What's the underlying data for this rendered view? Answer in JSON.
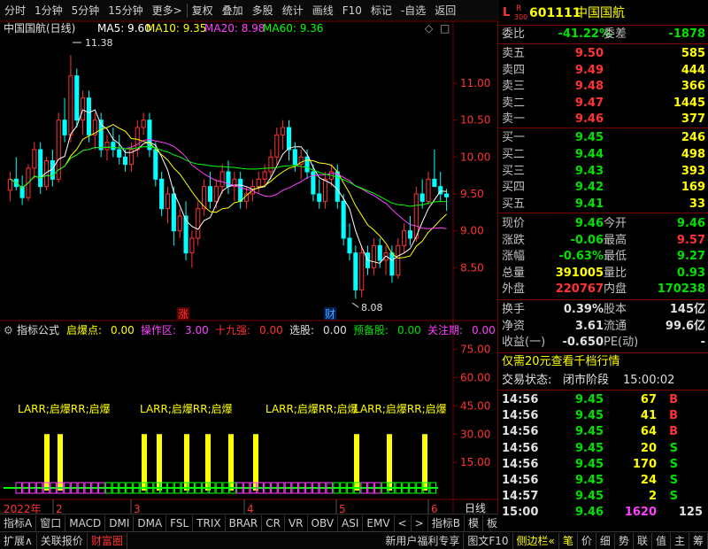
{
  "toolbar": {
    "items": [
      "分时",
      "1分钟",
      "5分钟",
      "15分钟",
      "更多>",
      "复权",
      "叠加",
      "多股",
      "统计",
      "画线",
      "F10",
      "标记",
      "-自选",
      "返回"
    ]
  },
  "chart": {
    "title": "中国国航(日线)",
    "ma": [
      {
        "label": "MA5: 9.60",
        "color": "#ffffff"
      },
      {
        "label": "MA10: 9.35",
        "color": "#ffff00"
      },
      {
        "label": "MA20: 8.98",
        "color": "#ff40ff"
      },
      {
        "label": "MA60: 9.36",
        "color": "#00ff00"
      }
    ],
    "price_ticks": [
      "11.00",
      "10.50",
      "10.00",
      "9.50",
      "9.00",
      "8.50"
    ],
    "high_label": "11.38",
    "low_label": "8.08",
    "marker_zhang": "涨",
    "marker_cai": "财",
    "indicator_ticks": [
      "75.00",
      "60.00",
      "45.00",
      "30.00",
      "15.00"
    ],
    "indicator_header": {
      "name": "指标公式",
      "items": [
        {
          "label": "启爆点:",
          "value": "0.00",
          "color": "#ffff00"
        },
        {
          "label": "操作区:",
          "value": "3.00",
          "color": "#ff40ff"
        },
        {
          "label": "十九强:",
          "value": "0.00",
          "color": "#ff3333"
        },
        {
          "label": "选股:",
          "value": "0.00",
          "color": "#e0e0e0"
        },
        {
          "label": "预备股:",
          "value": "0.00",
          "color": "#00e000"
        },
        {
          "label": "关注期:",
          "value": "0.00",
          "color": "#ff40ff"
        },
        {
          "label": "脱离!",
          "value": "",
          "color": "#4da6ff"
        }
      ]
    },
    "signal_labels": [
      "LARR;启爆RR;启爆",
      "LARR;启爆RR;启爆",
      "LARR;启爆RR;启爆",
      "LARR;启爆RR;启爆"
    ],
    "date_axis": {
      "year": "2022年",
      "months": [
        "2",
        "3",
        "4",
        "5",
        "6"
      ],
      "right": "日线"
    }
  },
  "indicator_tabs": [
    "指标A",
    "窗口",
    "MACD",
    "DMI",
    "DMA",
    "FSL",
    "TRIX",
    "BRAR",
    "CR",
    "VR",
    "OBV",
    "ASI",
    "EMV",
    "<",
    ">",
    "指标B",
    "模",
    "板",
    "+",
    "-",
    "«"
  ],
  "bottom_bar": {
    "left": [
      "扩展∧",
      "关联报价",
      "财富圈"
    ],
    "right_text": [
      "新用户福利专享",
      "图文F10",
      "侧边栏«"
    ],
    "tabs": [
      "笔",
      "价",
      "细",
      "势",
      "联",
      "值",
      "主",
      "筹"
    ]
  },
  "quote": {
    "market": "L",
    "flag_r": "R",
    "flag_300": "300",
    "code": "601111",
    "name": "中国国航",
    "weibi_label": "委比",
    "weibi": "-41.22%",
    "weicha_label": "委差",
    "weicha": "-1878",
    "asks": [
      {
        "label": "卖五",
        "price": "9.50",
        "vol": "585"
      },
      {
        "label": "卖四",
        "price": "9.49",
        "vol": "444"
      },
      {
        "label": "卖三",
        "price": "9.48",
        "vol": "366"
      },
      {
        "label": "卖二",
        "price": "9.47",
        "vol": "1445"
      },
      {
        "label": "卖一",
        "price": "9.46",
        "vol": "377"
      }
    ],
    "bids": [
      {
        "label": "买一",
        "price": "9.45",
        "vol": "246"
      },
      {
        "label": "买二",
        "price": "9.44",
        "vol": "498"
      },
      {
        "label": "买三",
        "price": "9.43",
        "vol": "393"
      },
      {
        "label": "买四",
        "price": "9.42",
        "vol": "169"
      },
      {
        "label": "买五",
        "price": "9.41",
        "vol": "33"
      }
    ],
    "stats": [
      {
        "l1": "现价",
        "v1": "9.46",
        "c1": "down",
        "l2": "今开",
        "v2": "9.46",
        "c2": "down"
      },
      {
        "l1": "涨跌",
        "v1": "-0.06",
        "c1": "down",
        "l2": "最高",
        "v2": "9.57",
        "c2": "up"
      },
      {
        "l1": "涨幅",
        "v1": "-0.63%",
        "c1": "down",
        "l2": "最低",
        "v2": "9.27",
        "c2": "down"
      },
      {
        "l1": "总量",
        "v1": "391005",
        "c1": "yel",
        "l2": "量比",
        "v2": "0.93",
        "c2": "down"
      },
      {
        "l1": "外盘",
        "v1": "220767",
        "c1": "up",
        "l2": "内盘",
        "v2": "170238",
        "c2": "down"
      }
    ],
    "stats2": [
      {
        "l1": "换手",
        "v1": "0.39%",
        "c1": "wht",
        "l2": "股本",
        "v2": "145亿",
        "c2": "wht"
      },
      {
        "l1": "净资",
        "v1": "3.61",
        "c1": "wht",
        "l2": "流通",
        "v2": "99.6亿",
        "c2": "wht"
      },
      {
        "l1": "收益(一)",
        "v1": "-0.650",
        "c1": "wht",
        "l2": "PE(动)",
        "v2": "-",
        "c2": "wht"
      }
    ],
    "promo": "仅需20元查看千档行情",
    "status_label": "交易状态:",
    "status_value": "闭市阶段",
    "status_time": "15:00:02",
    "ticks": [
      {
        "t": "14:56",
        "p": "9.45",
        "v": "67",
        "s": "B"
      },
      {
        "t": "14:56",
        "p": "9.45",
        "v": "41",
        "s": "B"
      },
      {
        "t": "14:56",
        "p": "9.45",
        "v": "64",
        "s": "B"
      },
      {
        "t": "14:56",
        "p": "9.45",
        "v": "20",
        "s": "S"
      },
      {
        "t": "14:56",
        "p": "9.45",
        "v": "170",
        "s": "S"
      },
      {
        "t": "14:56",
        "p": "9.45",
        "v": "24",
        "s": "S"
      },
      {
        "t": "14:57",
        "p": "9.45",
        "v": "2",
        "s": "S"
      },
      {
        "t": "15:00",
        "p": "9.46",
        "v": "1620",
        "s": "125"
      }
    ]
  },
  "colors": {
    "up": "#ff3333",
    "down": "#00e000",
    "border": "#7a0000",
    "ma5": "#ffffff",
    "ma10": "#ffff00",
    "ma20": "#ff40ff",
    "ma60": "#00ff00",
    "signal": "#ffff00"
  },
  "chart_data": {
    "type": "candlestick",
    "ylim": [
      8.0,
      11.6
    ],
    "candles": [
      [
        9.55,
        9.8,
        9.4,
        9.7
      ],
      [
        9.7,
        10.0,
        9.55,
        9.6
      ],
      [
        9.6,
        9.75,
        9.35,
        9.45
      ],
      [
        9.45,
        9.9,
        9.4,
        9.85
      ],
      [
        9.85,
        10.2,
        9.7,
        10.1
      ],
      [
        10.1,
        10.2,
        9.5,
        9.6
      ],
      [
        9.6,
        10.0,
        9.55,
        9.95
      ],
      [
        9.95,
        10.1,
        9.6,
        9.7
      ],
      [
        9.7,
        10.6,
        9.65,
        10.5
      ],
      [
        10.5,
        10.8,
        10.2,
        10.3
      ],
      [
        10.3,
        11.38,
        10.2,
        11.1
      ],
      [
        11.1,
        11.2,
        10.4,
        10.5
      ],
      [
        10.5,
        10.9,
        10.3,
        10.8
      ],
      [
        10.8,
        10.9,
        10.2,
        10.3
      ],
      [
        10.3,
        10.6,
        10.1,
        10.5
      ],
      [
        10.5,
        10.6,
        10.0,
        10.1
      ],
      [
        10.1,
        10.3,
        9.95,
        10.2
      ],
      [
        10.2,
        10.4,
        10.0,
        10.1
      ],
      [
        10.1,
        10.3,
        9.9,
        10.0
      ],
      [
        10.0,
        10.1,
        9.8,
        9.9
      ],
      [
        9.9,
        10.2,
        9.8,
        10.1
      ],
      [
        10.1,
        10.5,
        10.0,
        10.4
      ],
      [
        10.4,
        10.6,
        10.3,
        10.5
      ],
      [
        10.5,
        10.6,
        10.0,
        10.1
      ],
      [
        10.1,
        10.2,
        9.6,
        9.7
      ],
      [
        9.7,
        9.8,
        9.2,
        9.3
      ],
      [
        9.3,
        9.6,
        9.1,
        9.5
      ],
      [
        9.5,
        9.6,
        8.8,
        9.0
      ],
      [
        9.0,
        9.3,
        8.9,
        9.2
      ],
      [
        9.2,
        9.4,
        8.6,
        8.7
      ],
      [
        8.7,
        9.0,
        8.5,
        8.9
      ],
      [
        8.9,
        9.4,
        8.8,
        9.3
      ],
      [
        9.3,
        9.7,
        9.2,
        9.6
      ],
      [
        9.6,
        9.8,
        9.3,
        9.4
      ],
      [
        9.4,
        9.7,
        9.3,
        9.6
      ],
      [
        9.6,
        9.9,
        9.5,
        9.8
      ],
      [
        9.8,
        9.95,
        9.5,
        9.6
      ],
      [
        9.6,
        9.8,
        9.4,
        9.7
      ],
      [
        9.7,
        9.8,
        9.3,
        9.4
      ],
      [
        9.4,
        9.6,
        9.3,
        9.5
      ],
      [
        9.5,
        9.7,
        9.4,
        9.6
      ],
      [
        9.6,
        9.8,
        9.5,
        9.7
      ],
      [
        9.7,
        9.9,
        9.6,
        9.8
      ],
      [
        9.8,
        10.1,
        9.7,
        10.0
      ],
      [
        10.0,
        10.4,
        9.9,
        10.3
      ],
      [
        10.3,
        10.5,
        10.1,
        10.4
      ],
      [
        10.4,
        10.5,
        9.95,
        10.1
      ],
      [
        10.1,
        10.2,
        9.8,
        9.9
      ],
      [
        9.9,
        10.1,
        9.7,
        10.0
      ],
      [
        10.0,
        10.1,
        9.7,
        9.8
      ],
      [
        9.8,
        9.9,
        9.4,
        9.5
      ],
      [
        9.5,
        9.7,
        9.3,
        9.4
      ],
      [
        9.4,
        9.8,
        9.3,
        9.7
      ],
      [
        9.7,
        9.9,
        9.6,
        9.8
      ],
      [
        9.8,
        9.9,
        9.3,
        9.4
      ],
      [
        9.4,
        9.5,
        8.8,
        8.9
      ],
      [
        8.9,
        9.1,
        8.6,
        8.7
      ],
      [
        8.7,
        8.8,
        8.08,
        8.2
      ],
      [
        8.2,
        8.8,
        8.1,
        8.7
      ],
      [
        8.7,
        8.8,
        8.4,
        8.5
      ],
      [
        8.5,
        8.9,
        8.4,
        8.8
      ],
      [
        8.8,
        8.9,
        8.5,
        8.6
      ],
      [
        8.6,
        8.8,
        8.4,
        8.7
      ],
      [
        8.7,
        8.8,
        8.3,
        8.4
      ],
      [
        8.4,
        8.9,
        8.35,
        8.8
      ],
      [
        8.8,
        9.1,
        8.7,
        9.0
      ],
      [
        9.0,
        9.2,
        8.8,
        8.9
      ],
      [
        8.9,
        9.6,
        8.85,
        9.5
      ],
      [
        9.5,
        9.7,
        9.3,
        9.4
      ],
      [
        9.4,
        9.8,
        9.35,
        9.7
      ],
      [
        9.7,
        10.1,
        9.6,
        9.6
      ],
      [
        9.6,
        9.8,
        9.4,
        9.5
      ],
      [
        9.5,
        9.57,
        9.27,
        9.46
      ]
    ],
    "volumes": [],
    "signal_bars": [
      30,
      30,
      30,
      30,
      30,
      30,
      30,
      30,
      30,
      30,
      30
    ]
  }
}
